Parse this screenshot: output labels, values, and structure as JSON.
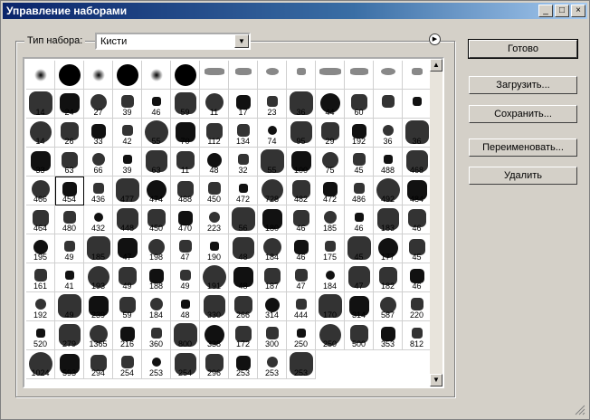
{
  "window": {
    "title": "Управление наборами",
    "minimize": "_",
    "maximize": "□",
    "close": "×"
  },
  "type_label": "Тип набора:",
  "combo": {
    "value": "Кисти",
    "arrow": "▼"
  },
  "menu_arrow": "▶",
  "buttons": {
    "done": "Готово",
    "load": "Загрузить...",
    "save": "Сохранить...",
    "rename": "Переименовать...",
    "delete": "Удалить"
  },
  "scroll": {
    "up": "▲",
    "down": "▼"
  },
  "brushes": [
    "",
    "",
    "",
    "",
    "",
    "",
    "",
    "",
    "",
    "",
    "",
    "",
    "",
    "",
    "14",
    "24",
    "27",
    "39",
    "46",
    "59",
    "11",
    "17",
    "23",
    "36",
    "44",
    "60",
    "",
    "",
    "14",
    "26",
    "33",
    "42",
    "55",
    "70",
    "112",
    "134",
    "74",
    "95",
    "29",
    "192",
    "36",
    "36",
    "33",
    "63",
    "66",
    "39",
    "63",
    "11",
    "48",
    "32",
    "55",
    "100",
    "75",
    "45",
    "488",
    "468",
    "466",
    "454",
    "436",
    "477",
    "474",
    "488",
    "450",
    "472",
    "728",
    "482",
    "472",
    "486",
    "492",
    "484",
    "464",
    "480",
    "432",
    "448",
    "450",
    "470",
    "223",
    "56",
    "180",
    "46",
    "185",
    "46",
    "183",
    "46",
    "195",
    "49",
    "185",
    "47",
    "198",
    "47",
    "190",
    "48",
    "184",
    "46",
    "175",
    "45",
    "177",
    "45",
    "161",
    "41",
    "193",
    "49",
    "188",
    "49",
    "191",
    "48",
    "187",
    "47",
    "184",
    "47",
    "182",
    "46",
    "192",
    "49",
    "239",
    "59",
    "184",
    "48",
    "330",
    "266",
    "314",
    "444",
    "170",
    "314",
    "587",
    "220",
    "520",
    "279",
    "1365",
    "216",
    "360",
    "800",
    "338",
    "172",
    "300",
    "250",
    "250",
    "500",
    "353",
    "812",
    "1024",
    "593",
    "294",
    "254",
    "253",
    "254",
    "296",
    "253",
    "253",
    "253"
  ]
}
